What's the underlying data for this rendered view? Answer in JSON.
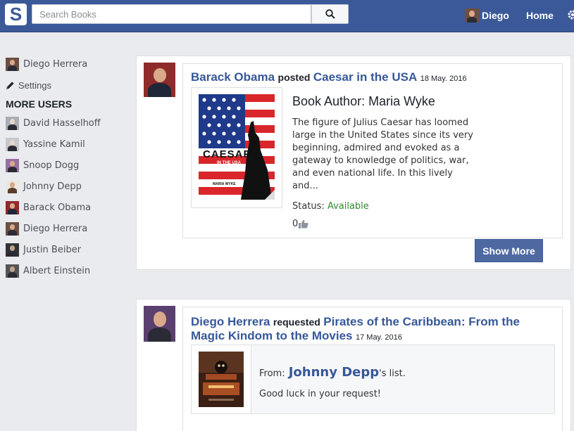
{
  "topbar": {
    "logo_letter": "S",
    "search_placeholder": "Search Books",
    "user_name": "Diego",
    "home_label": "Home"
  },
  "sidebar": {
    "current_user": "Diego Herrera",
    "settings_label": "Settings",
    "more_users_header": "MORE USERS",
    "users": [
      {
        "name": "David Hasselhoff"
      },
      {
        "name": "Yassine Kamil"
      },
      {
        "name": "Snoop Dogg"
      },
      {
        "name": "Johnny Depp"
      },
      {
        "name": "Barack Obama"
      },
      {
        "name": "Diego Herrera"
      },
      {
        "name": "Justin Beiber"
      },
      {
        "name": "Albert Einstein"
      }
    ]
  },
  "feed": [
    {
      "user": "Barack Obama",
      "verb": "posted",
      "book_title": "Caesar in the USA",
      "date": "18 May. 2016",
      "author_line": "Book Author: Maria Wyke",
      "description": "The figure of Julius Caesar has loomed large in the United States since its very beginning, admired and evoked as a gateway to knowledge of politics, war, and even national life. In this lively and...",
      "status_label": "Status:",
      "status_value": "Available",
      "likes": "0",
      "show_more_label": "Show More",
      "cover": {
        "title_line1": "CAESAR",
        "title_line2": "IN THE USA",
        "author": "MARIA WYKE"
      }
    },
    {
      "user": "Diego Herrera",
      "verb": "requested",
      "book_title": "Pirates of the Caribbean: From the Magic Kindom to the Movies",
      "date": "17 May. 2016",
      "from_label": "From:",
      "from_user": "Johnny Depp",
      "from_suffix": "'s list.",
      "message": "Good luck in your request!"
    }
  ],
  "colors": {
    "brand": "#3b5998",
    "link": "#365899",
    "available": "#2b8a2b",
    "background": "#e9ebee"
  }
}
